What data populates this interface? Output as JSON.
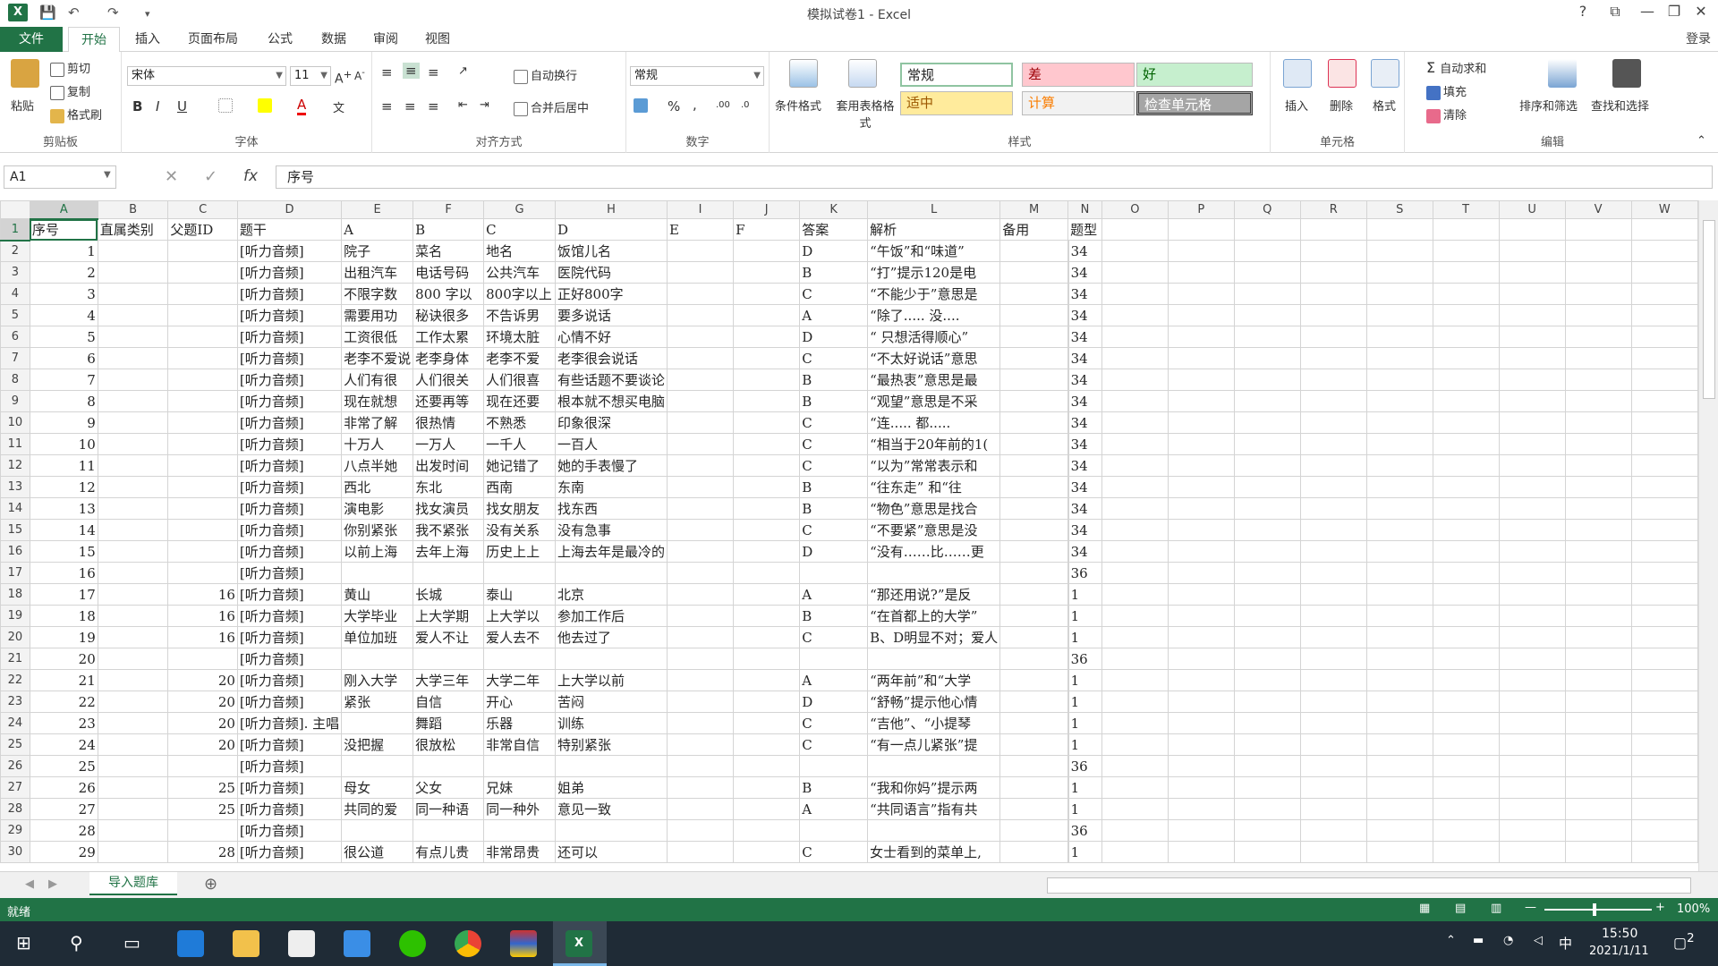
{
  "window": {
    "title": "模拟试卷1 - Excel",
    "help": "?",
    "controls": [
      "⧉",
      "—",
      "❐",
      "✕"
    ]
  },
  "tabs": [
    "文件",
    "开始",
    "插入",
    "页面布局",
    "公式",
    "数据",
    "审阅",
    "视图"
  ],
  "active_tab": "开始",
  "login": "登录",
  "ribbon": {
    "clipboard": {
      "label": "剪贴板",
      "paste": "粘贴",
      "cut": "剪切",
      "copy": "复制",
      "format_painter": "格式刷"
    },
    "font": {
      "label": "字体",
      "name": "宋体",
      "size": "11",
      "bold": "B",
      "italic": "I",
      "underline": "U"
    },
    "alignment": {
      "label": "对齐方式",
      "wrap": "自动换行",
      "merge": "合并后居中"
    },
    "number": {
      "label": "数字",
      "format": "常规",
      "percent": "%",
      "comma": ","
    },
    "styles": {
      "label": "样式",
      "conditional": "条件格式",
      "table": "套用表格格式",
      "cells": [
        {
          "name": "常规",
          "bg": "#ffffff",
          "fg": "#222222"
        },
        {
          "name": "差",
          "bg": "#ffc7ce",
          "fg": "#9c0006"
        },
        {
          "name": "好",
          "bg": "#c6efce",
          "fg": "#006100"
        },
        {
          "name": "适中",
          "bg": "#ffeb9c",
          "fg": "#9c5700"
        },
        {
          "name": "计算",
          "bg": "#f2f2f2",
          "fg": "#fa7d00"
        },
        {
          "name": "检查单元格",
          "bg": "#a5a5a5",
          "fg": "#ffffff"
        }
      ]
    },
    "cells": {
      "label": "单元格",
      "insert": "插入",
      "delete": "删除",
      "format": "格式"
    },
    "editing": {
      "label": "编辑",
      "autosum": "自动求和",
      "fill": "填充",
      "clear": "清除",
      "sort": "排序和筛选",
      "find": "查找和选择"
    }
  },
  "formula_bar": {
    "name_box": "A1",
    "fx": "fx",
    "content": "序号"
  },
  "columns": [
    "A",
    "B",
    "C",
    "D",
    "E",
    "F",
    "G",
    "H",
    "I",
    "J",
    "K",
    "L",
    "M",
    "N",
    "O",
    "P",
    "Q",
    "R",
    "S",
    "T",
    "U",
    "V",
    "W"
  ],
  "rows": [
    [
      "序号",
      "直属类别",
      "父题ID",
      "题干",
      "A",
      "B",
      "C",
      "D",
      "E",
      "F",
      "答案",
      "解析",
      "备用",
      "题型"
    ],
    [
      "1",
      "",
      "",
      "[听力音频]",
      "院子",
      "菜名",
      "地名",
      "饭馆儿名",
      "",
      "",
      "D",
      "“午饭”和“味道”",
      "",
      "34"
    ],
    [
      "2",
      "",
      "",
      "[听力音频]",
      "出租汽车",
      "电话号码",
      "公共汽车",
      "医院代码",
      "",
      "",
      "B",
      "“打”提示120是电",
      "",
      "34"
    ],
    [
      "3",
      "",
      "",
      "[听力音频]",
      "不限字数",
      "800 字以",
      "800字以上",
      "正好800字",
      "",
      "",
      "C",
      "“不能少于”意思是",
      "",
      "34"
    ],
    [
      "4",
      "",
      "",
      "[听力音频]",
      "需要用功",
      "秘诀很多",
      "不告诉男",
      "要多说话",
      "",
      "",
      "A",
      "“除了..... 没....",
      "",
      "34"
    ],
    [
      "5",
      "",
      "",
      "[听力音频]",
      "工资很低",
      "工作太累",
      "环境太脏",
      "心情不好",
      "",
      "",
      "D",
      "“ 只想活得顺心”",
      "",
      "34"
    ],
    [
      "6",
      "",
      "",
      "[听力音频]",
      "老李不爱说",
      "老李身体",
      "老李不爱",
      "老李很会说话",
      "",
      "",
      "C",
      "“不太好说话”意思",
      "",
      "34"
    ],
    [
      "7",
      "",
      "",
      "[听力音频]",
      "人们有很",
      "人们很关",
      "人们很喜",
      "有些话题不要谈论",
      "",
      "",
      "B",
      "“最热衷”意思是最",
      "",
      "34"
    ],
    [
      "8",
      "",
      "",
      "[听力音频]",
      "现在就想",
      "还要再等",
      "现在还要",
      "根本就不想买电脑",
      "",
      "",
      "B",
      "“观望”意思是不采",
      "",
      "34"
    ],
    [
      "9",
      "",
      "",
      "[听力音频]",
      "非常了解",
      "很热情",
      "不熟悉",
      "印象很深",
      "",
      "",
      "C",
      "“连..... 都.....",
      "",
      "34"
    ],
    [
      "10",
      "",
      "",
      "[听力音频]",
      "十万人",
      "一万人",
      "一千人",
      "一百人",
      "",
      "",
      "C",
      "“相当于20年前的1(",
      "",
      "34"
    ],
    [
      "11",
      "",
      "",
      "[听力音频]",
      "八点半她",
      "出发时间",
      "她记错了",
      "她的手表慢了",
      "",
      "",
      "C",
      "“以为”常常表示和",
      "",
      "34"
    ],
    [
      "12",
      "",
      "",
      "[听力音频]",
      "西北",
      "东北",
      "西南",
      "东南",
      "",
      "",
      "B",
      "“往东走” 和“往",
      "",
      "34"
    ],
    [
      "13",
      "",
      "",
      "[听力音频]",
      "演电影",
      "找女演员",
      "找女朋友",
      "找东西",
      "",
      "",
      "B",
      "“物色”意思是找合",
      "",
      "34"
    ],
    [
      "14",
      "",
      "",
      "[听力音频]",
      "你别紧张",
      "我不紧张",
      "没有关系",
      "没有急事",
      "",
      "",
      "C",
      "“不要紧”意思是没",
      "",
      "34"
    ],
    [
      "15",
      "",
      "",
      "[听力音频]",
      "以前上海",
      "去年上海",
      "历史上上",
      "上海去年是最冷的",
      "",
      "",
      "D",
      "“没有……比……更",
      "",
      "34"
    ],
    [
      "16",
      "",
      "",
      "[听力音频]",
      "",
      "",
      "",
      "",
      "",
      "",
      "",
      "",
      "",
      "36"
    ],
    [
      "17",
      "",
      "16",
      "[听力音频]",
      "黄山",
      "长城",
      "泰山",
      "北京",
      "",
      "",
      "A",
      "“那还用说?”是反",
      "",
      "1"
    ],
    [
      "18",
      "",
      "16",
      "[听力音频]",
      "大学毕业",
      "上大学期",
      "上大学以",
      "参加工作后",
      "",
      "",
      "B",
      "“在首都上的大学”",
      "",
      "1"
    ],
    [
      "19",
      "",
      "16",
      "[听力音频]",
      "单位加班",
      "爱人不让",
      "爱人去不",
      "他去过了",
      "",
      "",
      "C",
      "B、D明显不对；爱人",
      "",
      "1"
    ],
    [
      "20",
      "",
      "",
      "[听力音频]",
      "",
      "",
      "",
      "",
      "",
      "",
      "",
      "",
      "",
      "36"
    ],
    [
      "21",
      "",
      "20",
      "[听力音频]",
      "刚入大学",
      "大学三年",
      "大学二年",
      "上大学以前",
      "",
      "",
      "A",
      "“两年前”和“大学",
      "",
      "1"
    ],
    [
      "22",
      "",
      "20",
      "[听力音频]",
      "紧张",
      "自信",
      "开心",
      "苦闷",
      "",
      "",
      "D",
      "“舒畅”提示他心情",
      "",
      "1"
    ],
    [
      "23",
      "",
      "20",
      "[听力音频]. 主唱",
      "",
      "舞蹈",
      "乐器",
      "训练",
      "",
      "",
      "C",
      "“吉他”、“小提琴",
      "",
      "1"
    ],
    [
      "24",
      "",
      "20",
      "[听力音频]",
      "没把握",
      "很放松",
      "非常自信",
      "特别紧张",
      "",
      "",
      "C",
      "“有一点儿紧张”提",
      "",
      "1"
    ],
    [
      "25",
      "",
      "",
      "[听力音频]",
      "",
      "",
      "",
      "",
      "",
      "",
      "",
      "",
      "",
      "36"
    ],
    [
      "26",
      "",
      "25",
      "[听力音频]",
      "母女",
      "父女",
      "兄妹",
      "姐弟",
      "",
      "",
      "B",
      "“我和你妈”提示两",
      "",
      "1"
    ],
    [
      "27",
      "",
      "25",
      "[听力音频]",
      "共同的爱",
      "同一种语",
      "同一种外",
      "意见一致",
      "",
      "",
      "A",
      "“共同语言”指有共",
      "",
      "1"
    ],
    [
      "28",
      "",
      "",
      "[听力音频]",
      "",
      "",
      "",
      "",
      "",
      "",
      "",
      "",
      "",
      "36"
    ],
    [
      "29",
      "",
      "28",
      "[听力音频]",
      "很公道",
      "有点儿贵",
      "非常昂贵",
      "还可以",
      "",
      "",
      "C",
      "女士看到的菜单上,",
      "",
      "1"
    ]
  ],
  "sheet_tab": "导入题库",
  "status": {
    "ready": "就绪",
    "zoom": "100%"
  },
  "taskbar": {
    "time": "15:50",
    "date": "2021/1/11",
    "ime": "中",
    "notif": "2"
  }
}
